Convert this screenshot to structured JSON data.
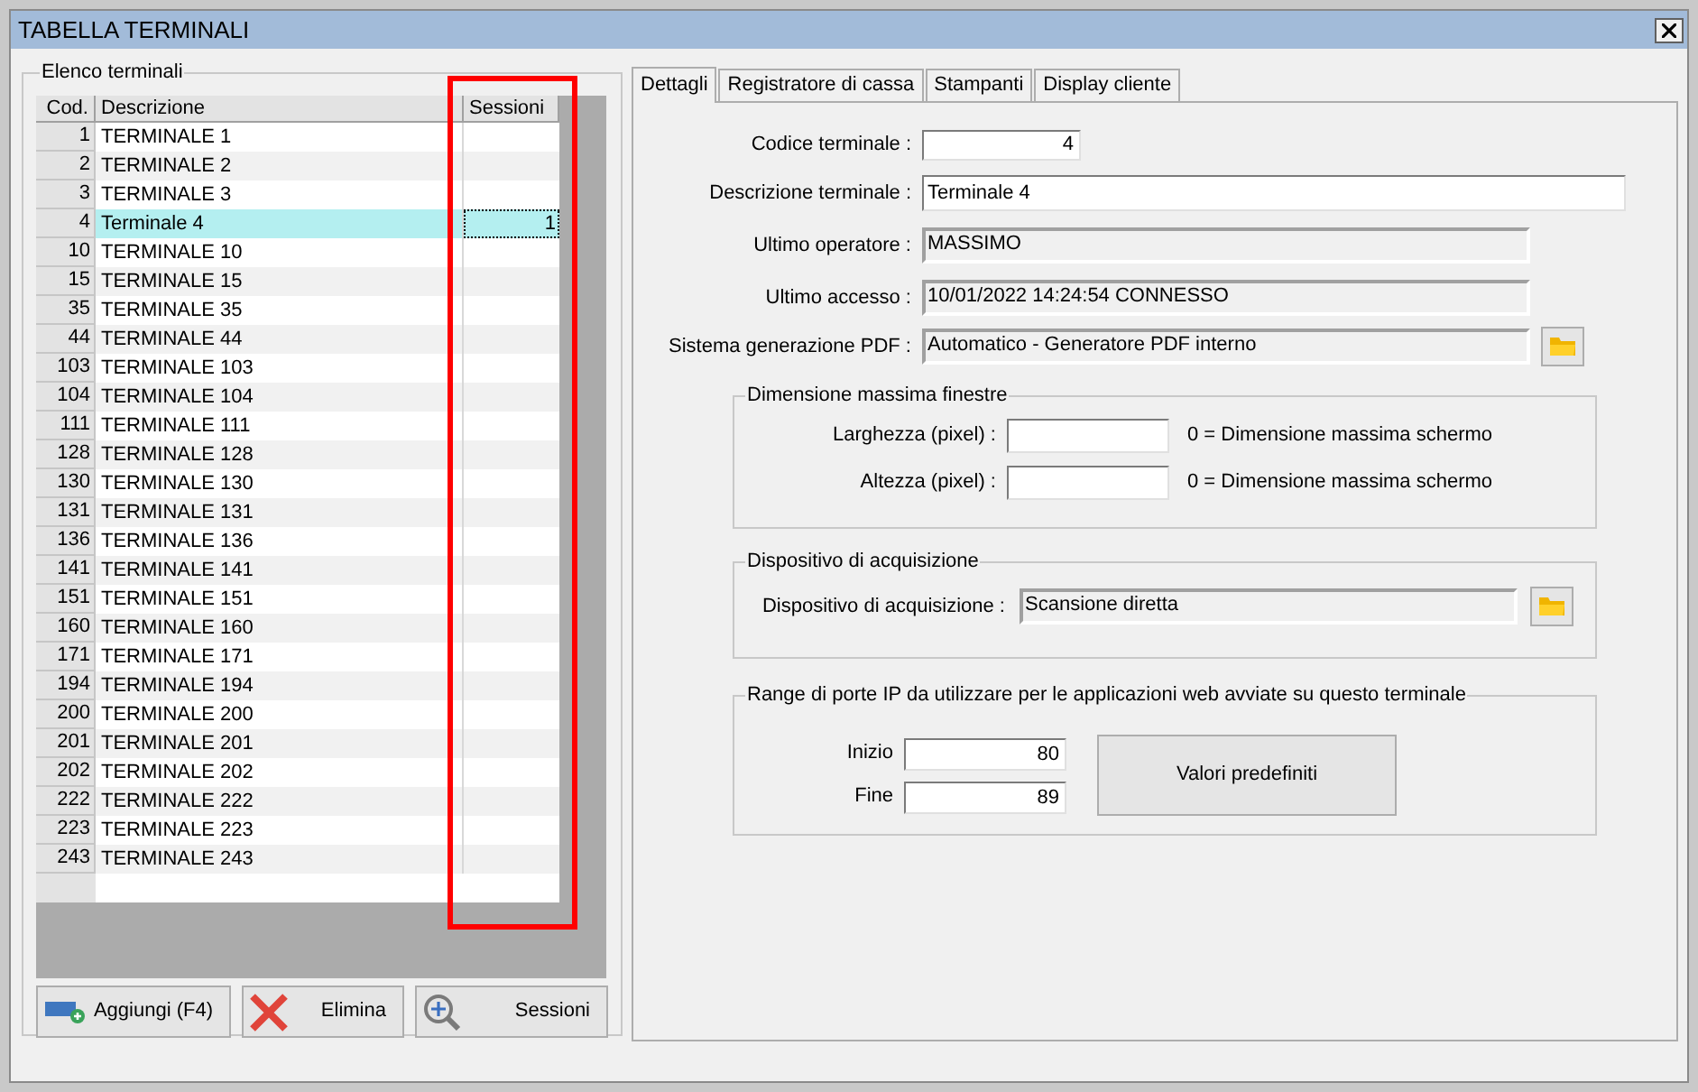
{
  "window": {
    "title": "TABELLA TERMINALI"
  },
  "terminal_list": {
    "title": "Elenco terminali",
    "columns": [
      {
        "label": "Cod.",
        "highlighted": false
      },
      {
        "label": "Descrizione",
        "highlighted": false
      },
      {
        "label": "Sessioni",
        "highlighted": true
      }
    ],
    "rows": [
      {
        "code": "1",
        "description": "TERMINALE 1",
        "selected": false
      },
      {
        "code": "2",
        "description": "TERMINALE 2",
        "selected": false
      },
      {
        "code": "3",
        "description": "TERMINALE 3",
        "selected": false
      },
      {
        "code": "4",
        "description": "Terminale 4",
        "sessions": "1",
        "selected": true
      },
      {
        "code": "10",
        "description": "TERMINALE 10",
        "selected": false
      },
      {
        "code": "15",
        "description": "TERMINALE 15",
        "selected": false
      },
      {
        "code": "35",
        "description": "TERMINALE 35",
        "selected": false
      },
      {
        "code": "44",
        "description": "TERMINALE 44",
        "selected": false
      },
      {
        "code": "103",
        "description": "TERMINALE 103",
        "selected": false
      },
      {
        "code": "104",
        "description": "TERMINALE 104",
        "selected": false
      },
      {
        "code": "111",
        "description": "TERMINALE 111",
        "selected": false
      },
      {
        "code": "128",
        "description": "TERMINALE 128",
        "selected": false
      },
      {
        "code": "130",
        "description": "TERMINALE 130",
        "selected": false
      },
      {
        "code": "131",
        "description": "TERMINALE 131",
        "selected": false
      },
      {
        "code": "136",
        "description": "TERMINALE 136",
        "selected": false
      },
      {
        "code": "141",
        "description": "TERMINALE 141",
        "selected": false
      },
      {
        "code": "151",
        "description": "TERMINALE 151",
        "selected": false
      },
      {
        "code": "160",
        "description": "TERMINALE 160",
        "selected": false
      },
      {
        "code": "171",
        "description": "TERMINALE 171",
        "selected": false
      },
      {
        "code": "194",
        "description": "TERMINALE 194",
        "selected": false
      },
      {
        "code": "200",
        "description": "TERMINALE 200",
        "selected": false
      },
      {
        "code": "201",
        "description": "TERMINALE 201",
        "selected": false
      },
      {
        "code": "202",
        "description": "TERMINALE 202",
        "selected": false
      },
      {
        "code": "222",
        "description": "TERMINALE 222",
        "selected": false
      },
      {
        "code": "223",
        "description": "TERMINALE 223",
        "selected": false
      },
      {
        "code": "243",
        "description": "TERMINALE 243",
        "selected": false
      }
    ],
    "buttons": [
      {
        "label": "Aggiungi (F4)",
        "kind": "add"
      },
      {
        "label": "Elimina",
        "kind": "delete"
      },
      {
        "label": "Sessioni",
        "kind": "sessions"
      }
    ]
  },
  "tabs": [
    {
      "label": "Dettagli",
      "selected": true
    },
    {
      "label": "Registratore di cassa",
      "selected": false
    },
    {
      "label": "Stampanti",
      "selected": false
    },
    {
      "label": "Display cliente",
      "selected": false
    }
  ],
  "details": {
    "fields": [
      {
        "label": "Codice terminale :",
        "value": "4",
        "kind": "number"
      },
      {
        "label": "Descrizione terminale :",
        "value": "Terminale 4",
        "kind": "text"
      },
      {
        "label": "Ultimo operatore :",
        "value": "MASSIMO",
        "kind": "readonly"
      },
      {
        "label": "Ultimo accesso :",
        "value": "10/01/2022  14:24:54  CONNESSO",
        "kind": "readonly"
      },
      {
        "label": "Sistema generazione PDF :",
        "value": "Automatico - Generatore PDF interno",
        "kind": "browse"
      }
    ],
    "window_size": {
      "title": "Dimensione massima finestre",
      "fields": [
        {
          "label": "Larghezza (pixel) :",
          "hint": "0 = Dimensione massima schermo"
        },
        {
          "label": "Altezza (pixel) :",
          "hint": "0 = Dimensione massima schermo"
        }
      ]
    },
    "acquisition": {
      "title": "Dispositivo di acquisizione",
      "label": "Dispositivo di acquisizione :",
      "value": "Scansione diretta"
    },
    "ports": {
      "title": "Range di porte IP da utilizzare per le applicazioni web avviate su questo terminale",
      "fields": [
        {
          "label": "Inizio",
          "value": "80"
        },
        {
          "label": "Fine",
          "value": "89"
        }
      ],
      "button": "Valori predefiniti"
    }
  }
}
